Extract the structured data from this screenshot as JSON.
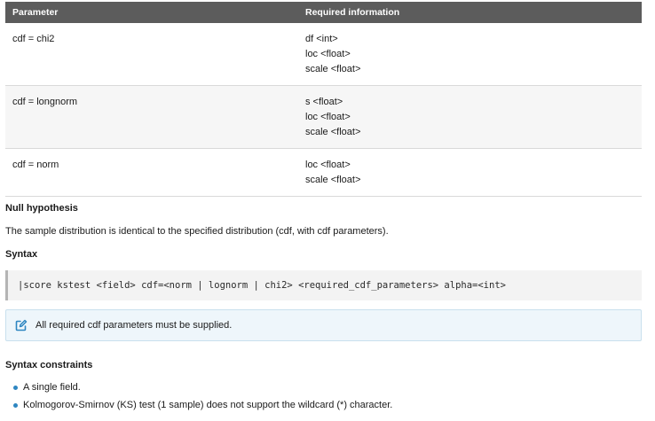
{
  "table": {
    "headers": [
      "Parameter",
      "Required information"
    ],
    "rows": [
      {
        "parameter": "cdf = chi2",
        "required": [
          "df <int>",
          "loc <float>",
          "scale <float>"
        ]
      },
      {
        "parameter": "cdf = longnorm",
        "required": [
          "s <float>",
          "loc <float>",
          "scale <float>"
        ]
      },
      {
        "parameter": "cdf = norm",
        "required": [
          "loc <float>",
          "scale <float>"
        ]
      }
    ]
  },
  "null_hypothesis": {
    "heading": "Null hypothesis",
    "text": "The sample distribution is identical to the specified distribution (cdf, with cdf parameters)."
  },
  "syntax": {
    "heading": "Syntax",
    "code": "|score kstest <field> cdf=<norm | lognorm | chi2> <required_cdf_parameters> alpha=<int>"
  },
  "note": {
    "icon": "edit-note-icon",
    "text": "All required cdf parameters must be supplied."
  },
  "constraints": {
    "heading": "Syntax constraints",
    "items": [
      "A single field.",
      "Kolmogorov-Smirnov (KS) test (1 sample) does not support the wildcard (*) character."
    ]
  },
  "colors": {
    "header_bg": "#5c5c5c",
    "accent": "#2e86c1",
    "note_bg": "#eef6fb"
  }
}
